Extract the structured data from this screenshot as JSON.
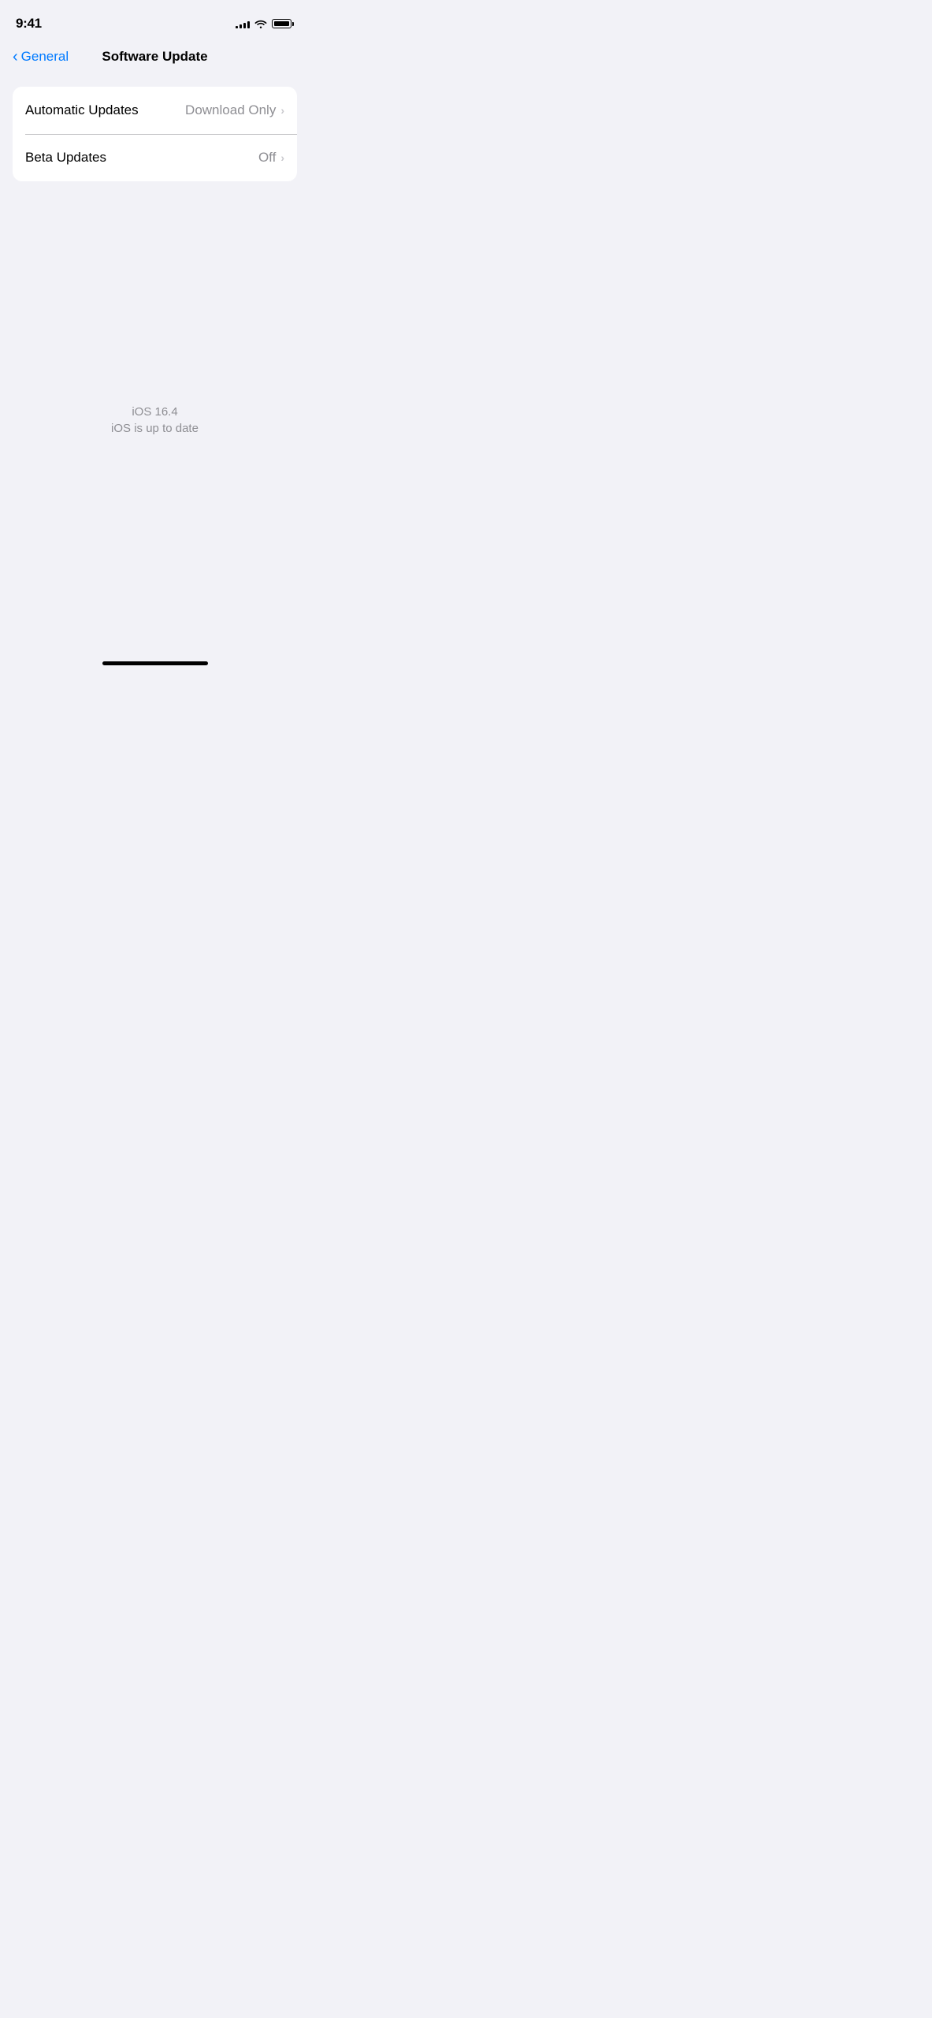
{
  "statusBar": {
    "time": "9:41",
    "signal": {
      "bars": [
        3,
        5,
        7,
        9,
        11
      ],
      "filled": [
        true,
        true,
        true,
        true,
        true
      ]
    },
    "battery": {
      "percent": 100
    }
  },
  "navBar": {
    "backLabel": "General",
    "title": "Software Update"
  },
  "settingsGroup": {
    "rows": [
      {
        "label": "Automatic Updates",
        "value": "Download Only",
        "hasChevron": true
      },
      {
        "label": "Beta Updates",
        "value": "Off",
        "hasChevron": true
      }
    ]
  },
  "iosInfo": {
    "version": "iOS 16.4",
    "status": "iOS is up to date"
  },
  "homeIndicator": {}
}
